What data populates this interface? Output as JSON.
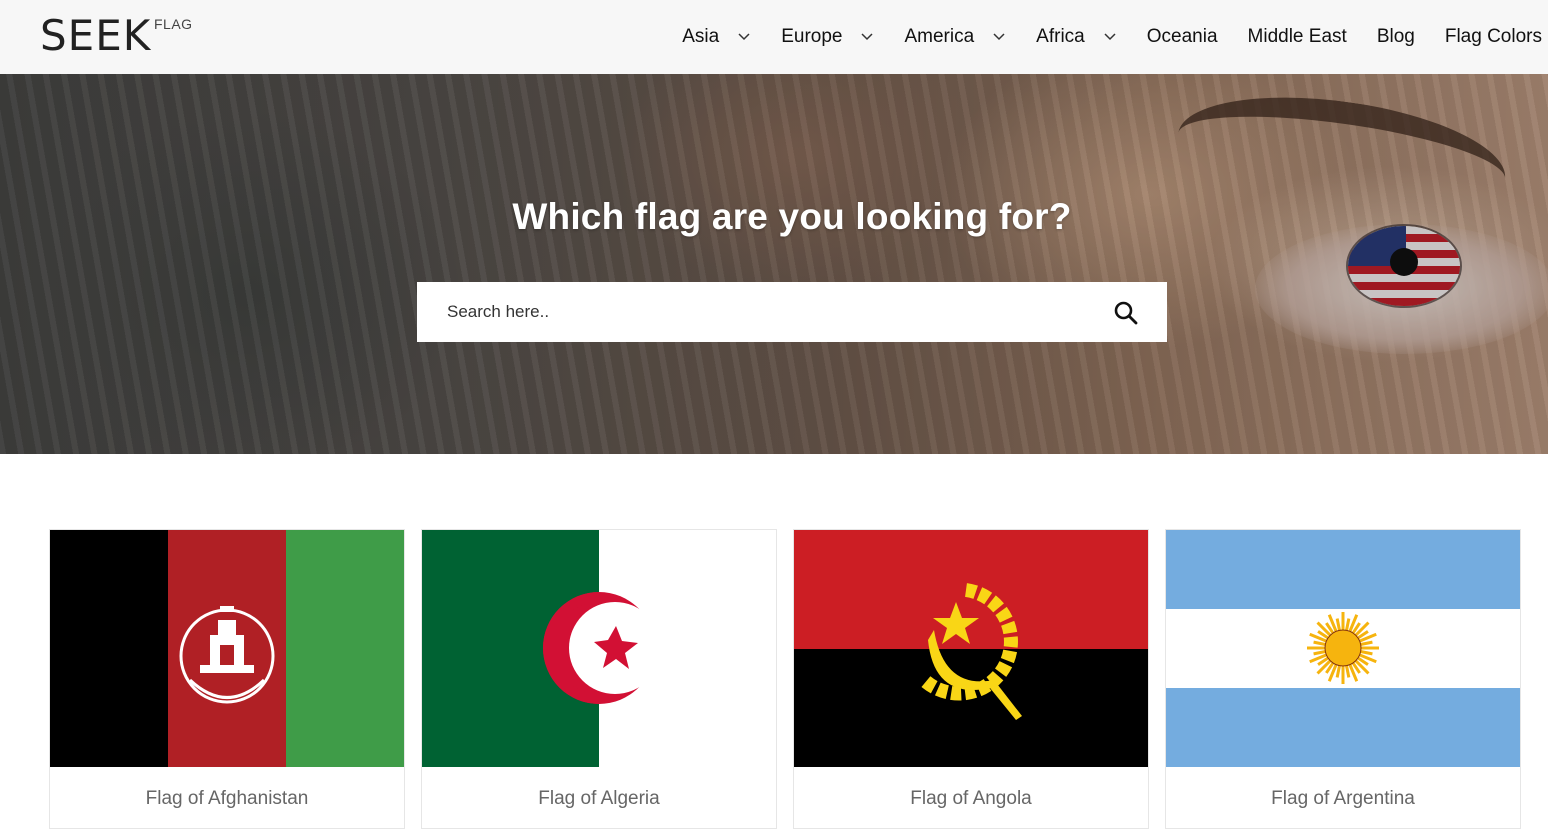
{
  "brand": {
    "name": "SEEK",
    "sub": "FLAG"
  },
  "nav": [
    {
      "label": "Asia",
      "dropdown": true
    },
    {
      "label": "Europe",
      "dropdown": true
    },
    {
      "label": "America",
      "dropdown": true
    },
    {
      "label": "Africa",
      "dropdown": true
    },
    {
      "label": "Oceania",
      "dropdown": false
    },
    {
      "label": "Middle East",
      "dropdown": false
    },
    {
      "label": "Blog",
      "dropdown": false
    },
    {
      "label": "Flag Colors",
      "dropdown": false
    }
  ],
  "hero": {
    "title": "Which flag are you looking for?",
    "search_placeholder": "Search here..",
    "search_icon": "search-icon"
  },
  "cards": [
    {
      "label": "Flag of Afghanistan",
      "colors": [
        "#000000",
        "#b02025",
        "#3f9c48"
      ]
    },
    {
      "label": "Flag of Algeria",
      "colors": [
        "#006233",
        "#ffffff",
        "#d21034"
      ]
    },
    {
      "label": "Flag of Angola",
      "colors": [
        "#cc1e24",
        "#000000",
        "#f9d616"
      ]
    },
    {
      "label": "Flag of Argentina",
      "colors": [
        "#74acdf",
        "#ffffff",
        "#f6b40e"
      ]
    }
  ]
}
